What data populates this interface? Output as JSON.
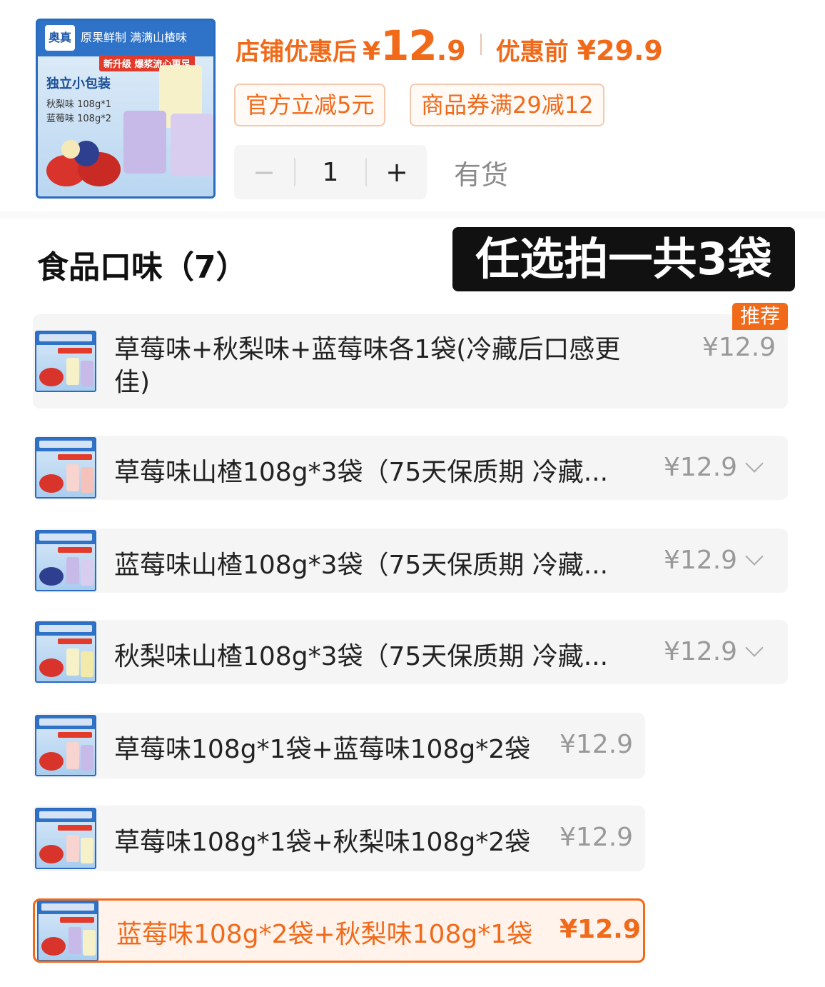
{
  "hero": {
    "logo_text": "奥真",
    "tagline": "原果鲜制 满满山楂味",
    "upgrade_badge": "新升级 爆浆流心更足",
    "pack_title": "独立小包装",
    "line1": "秋梨味 108g*1",
    "line2": "蓝莓味 108g*2"
  },
  "price": {
    "after_label": "店铺优惠后",
    "yen": "¥",
    "after_int": "12",
    "after_dec": ".9",
    "before_label": "优惠前",
    "before_value": "¥29.9",
    "color": "#f06a1a"
  },
  "coupons": [
    "官方立减5元",
    "商品券满29减12"
  ],
  "quantity": {
    "minus": "−",
    "value": "1",
    "plus": "+",
    "stock": "有货"
  },
  "section": {
    "title": "食品口味（7）",
    "promo": "任选拍一共3袋"
  },
  "recommend_badge": "推荐",
  "options": [
    {
      "label_line1": "草莓味+秋梨味+蓝莓味各1袋(冷藏后口感更",
      "label_line2": "佳)",
      "price": "¥12.9"
    },
    {
      "label": "草莓味山楂108g*3袋（75天保质期 冷藏...",
      "price": "¥12.9"
    },
    {
      "label": "蓝莓味山楂108g*3袋（75天保质期 冷藏...",
      "price": "¥12.9"
    },
    {
      "label": "秋梨味山楂108g*3袋（75天保质期 冷藏...",
      "price": "¥12.9"
    },
    {
      "label": "草莓味108g*1袋+蓝莓味108g*2袋",
      "price": "¥12.9"
    },
    {
      "label": "草莓味108g*1袋+秋梨味108g*2袋",
      "price": "¥12.9"
    },
    {
      "label": "蓝莓味108g*2袋+秋梨味108g*1袋",
      "price": "¥12.9",
      "selected": true
    }
  ]
}
